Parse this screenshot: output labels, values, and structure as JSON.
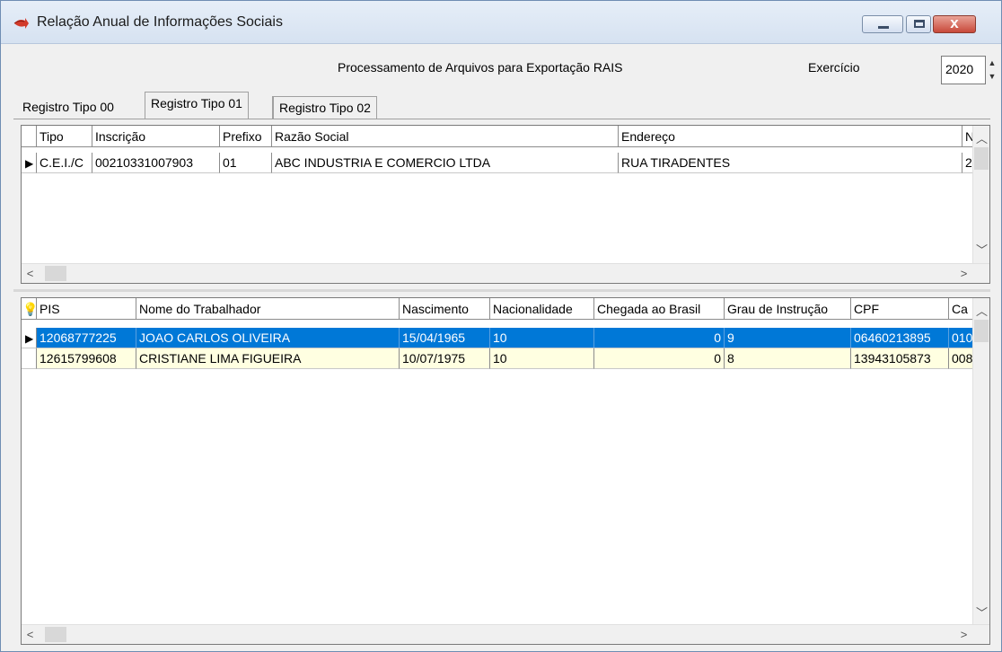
{
  "window": {
    "title": "Relação Anual de Informações Sociais",
    "close_glyph": "x"
  },
  "header": {
    "title": "Processamento de Arquivos para Exportação RAIS",
    "exercicio_label": "Exercício",
    "exercicio_value": "2020"
  },
  "tabs": [
    {
      "label": "Registro Tipo 00"
    },
    {
      "label": "Registro Tipo 01"
    },
    {
      "label": "Registro Tipo 02"
    }
  ],
  "grid_top": {
    "columns": [
      "Tipo",
      "Inscrição",
      "Prefixo",
      "Razão Social",
      "Endereço",
      "N"
    ],
    "rows": [
      [
        "C.E.I./C",
        "00210331007903",
        "01",
        "ABC INDUSTRIA E COMERCIO LTDA",
        "RUA TIRADENTES",
        "2"
      ]
    ]
  },
  "grid_bottom": {
    "columns": [
      "PIS",
      "Nome do Trabalhador",
      "Nascimento",
      "Nacionalidade",
      "Chegada ao Brasil",
      "Grau de Instrução",
      "CPF",
      "Ca"
    ],
    "rows": [
      [
        "12068777225",
        "JOAO CARLOS OLIVEIRA",
        "15/04/1965",
        "10",
        "0",
        "9",
        "06460213895",
        "010"
      ],
      [
        "12615799608",
        "CRISTIANE LIMA FIGUEIRA",
        "10/07/1975",
        "10",
        "0",
        "8",
        "13943105873",
        "008"
      ]
    ]
  },
  "icons": {
    "app": "red-arrow-icon",
    "row_indicator": "triangle-right-icon",
    "bulb": "lightbulb-icon"
  },
  "colors": {
    "selection": "#0078d7",
    "alt_row": "#ffffe1",
    "title_gradient": "#d6e2f1",
    "close_button": "#c8493a"
  }
}
